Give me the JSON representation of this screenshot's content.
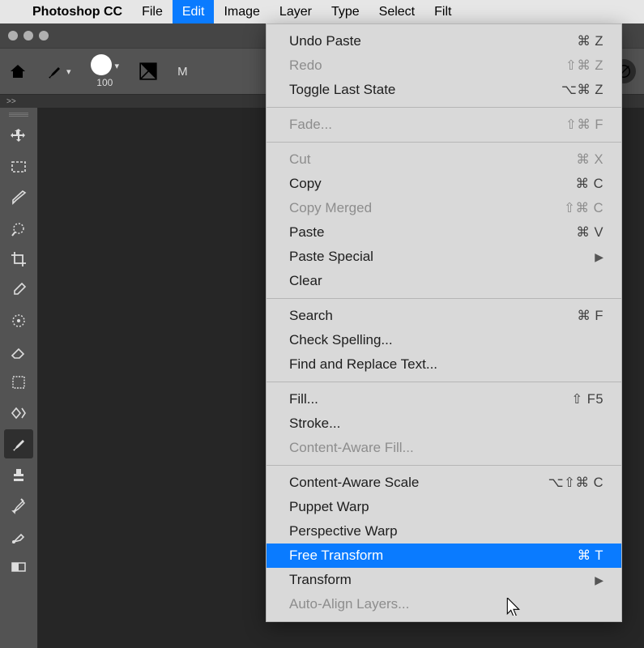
{
  "menubar": {
    "app": "Photoshop CC",
    "items": [
      "File",
      "Edit",
      "Image",
      "Layer",
      "Type",
      "Select",
      "Filt"
    ]
  },
  "options_bar": {
    "brush_size_label": "100",
    "right_letter": "M"
  },
  "tabstrip": {
    "chevrons": ">>"
  },
  "tools": [
    {
      "id": "move",
      "svg": "move"
    },
    {
      "id": "marquee",
      "svg": "marquee"
    },
    {
      "id": "lasso",
      "svg": "lasso"
    },
    {
      "id": "magic",
      "svg": "magic"
    },
    {
      "id": "crop",
      "svg": "crop"
    },
    {
      "id": "eyedrop",
      "svg": "eyedrop"
    },
    {
      "id": "spot",
      "svg": "spot"
    },
    {
      "id": "eraser",
      "svg": "eraser"
    },
    {
      "id": "patch",
      "svg": "patch"
    },
    {
      "id": "dodge",
      "svg": "dodge"
    },
    {
      "id": "brush",
      "svg": "brush",
      "active": true
    },
    {
      "id": "stamp",
      "svg": "stamp"
    },
    {
      "id": "hist",
      "svg": "hist"
    },
    {
      "id": "mix",
      "svg": "mix"
    },
    {
      "id": "grad",
      "svg": "grad"
    }
  ],
  "edit_menu": [
    {
      "label": "Undo Paste",
      "shortcut": "⌘ Z",
      "disabled": false
    },
    {
      "label": "Redo",
      "shortcut": "⇧⌘ Z",
      "disabled": true
    },
    {
      "label": "Toggle Last State",
      "shortcut": "⌥⌘ Z",
      "disabled": false
    },
    {
      "sep": true
    },
    {
      "label": "Fade...",
      "shortcut": "⇧⌘ F",
      "disabled": true
    },
    {
      "sep": true
    },
    {
      "label": "Cut",
      "shortcut": "⌘ X",
      "disabled": true
    },
    {
      "label": "Copy",
      "shortcut": "⌘ C",
      "disabled": false
    },
    {
      "label": "Copy Merged",
      "shortcut": "⇧⌘ C",
      "disabled": true
    },
    {
      "label": "Paste",
      "shortcut": "⌘ V",
      "disabled": false
    },
    {
      "label": "Paste Special",
      "shortcut": "",
      "submenu": true,
      "disabled": false
    },
    {
      "label": "Clear",
      "shortcut": "",
      "disabled": false
    },
    {
      "sep": true
    },
    {
      "label": "Search",
      "shortcut": "⌘ F",
      "disabled": false
    },
    {
      "label": "Check Spelling...",
      "shortcut": "",
      "disabled": false
    },
    {
      "label": "Find and Replace Text...",
      "shortcut": "",
      "disabled": false
    },
    {
      "sep": true
    },
    {
      "label": "Fill...",
      "shortcut": "⇧ F5",
      "disabled": false
    },
    {
      "label": "Stroke...",
      "shortcut": "",
      "disabled": false
    },
    {
      "label": "Content-Aware Fill...",
      "shortcut": "",
      "disabled": true
    },
    {
      "sep": true
    },
    {
      "label": "Content-Aware Scale",
      "shortcut": "⌥⇧⌘ C",
      "disabled": false
    },
    {
      "label": "Puppet Warp",
      "shortcut": "",
      "disabled": false
    },
    {
      "label": "Perspective Warp",
      "shortcut": "",
      "disabled": false
    },
    {
      "label": "Free Transform",
      "shortcut": "⌘ T",
      "disabled": false,
      "highlight": true
    },
    {
      "label": "Transform",
      "shortcut": "",
      "submenu": true,
      "disabled": false
    },
    {
      "label": "Auto-Align Layers...",
      "shortcut": "",
      "disabled": true
    }
  ]
}
